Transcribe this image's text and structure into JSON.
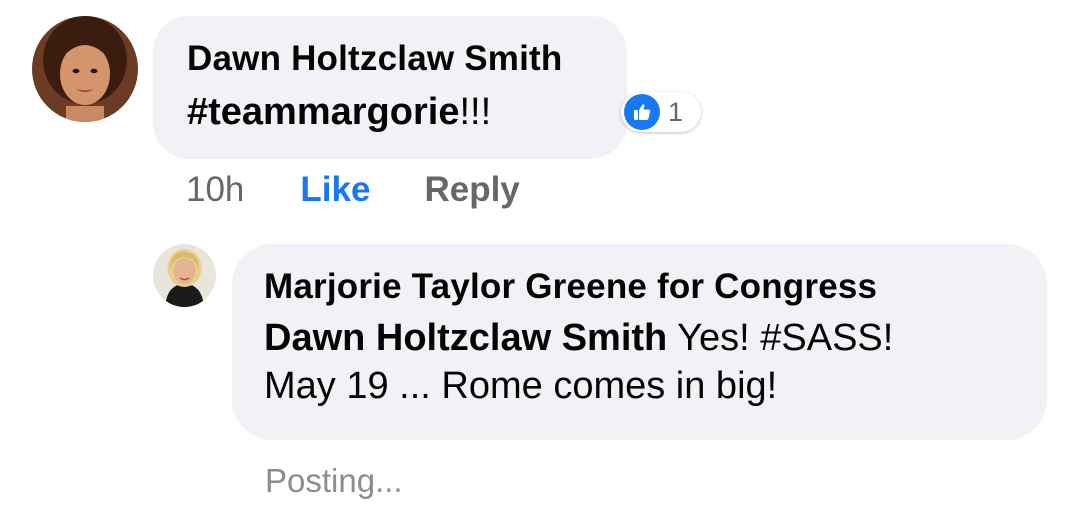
{
  "comment": {
    "author": "Dawn Holtzclaw Smith",
    "text_hashtag": "#teammargorie",
    "text_rest": "!!!",
    "reaction_count": "1",
    "timestamp": "10h",
    "like_label": "Like",
    "reply_label": "Reply"
  },
  "reply": {
    "author": "Marjorie Taylor Greene for Congress",
    "mention": "Dawn Holtzclaw Smith",
    "text_line1_rest": " Yes! #SASS!",
    "text_line2": "May 19 ... Rome comes in big!",
    "status": "Posting..."
  },
  "colors": {
    "bubble": "#f0f2f5",
    "link_blue": "#1877f2",
    "muted": "#65676b"
  },
  "icons": {
    "reaction": "thumbs-up-icon"
  }
}
